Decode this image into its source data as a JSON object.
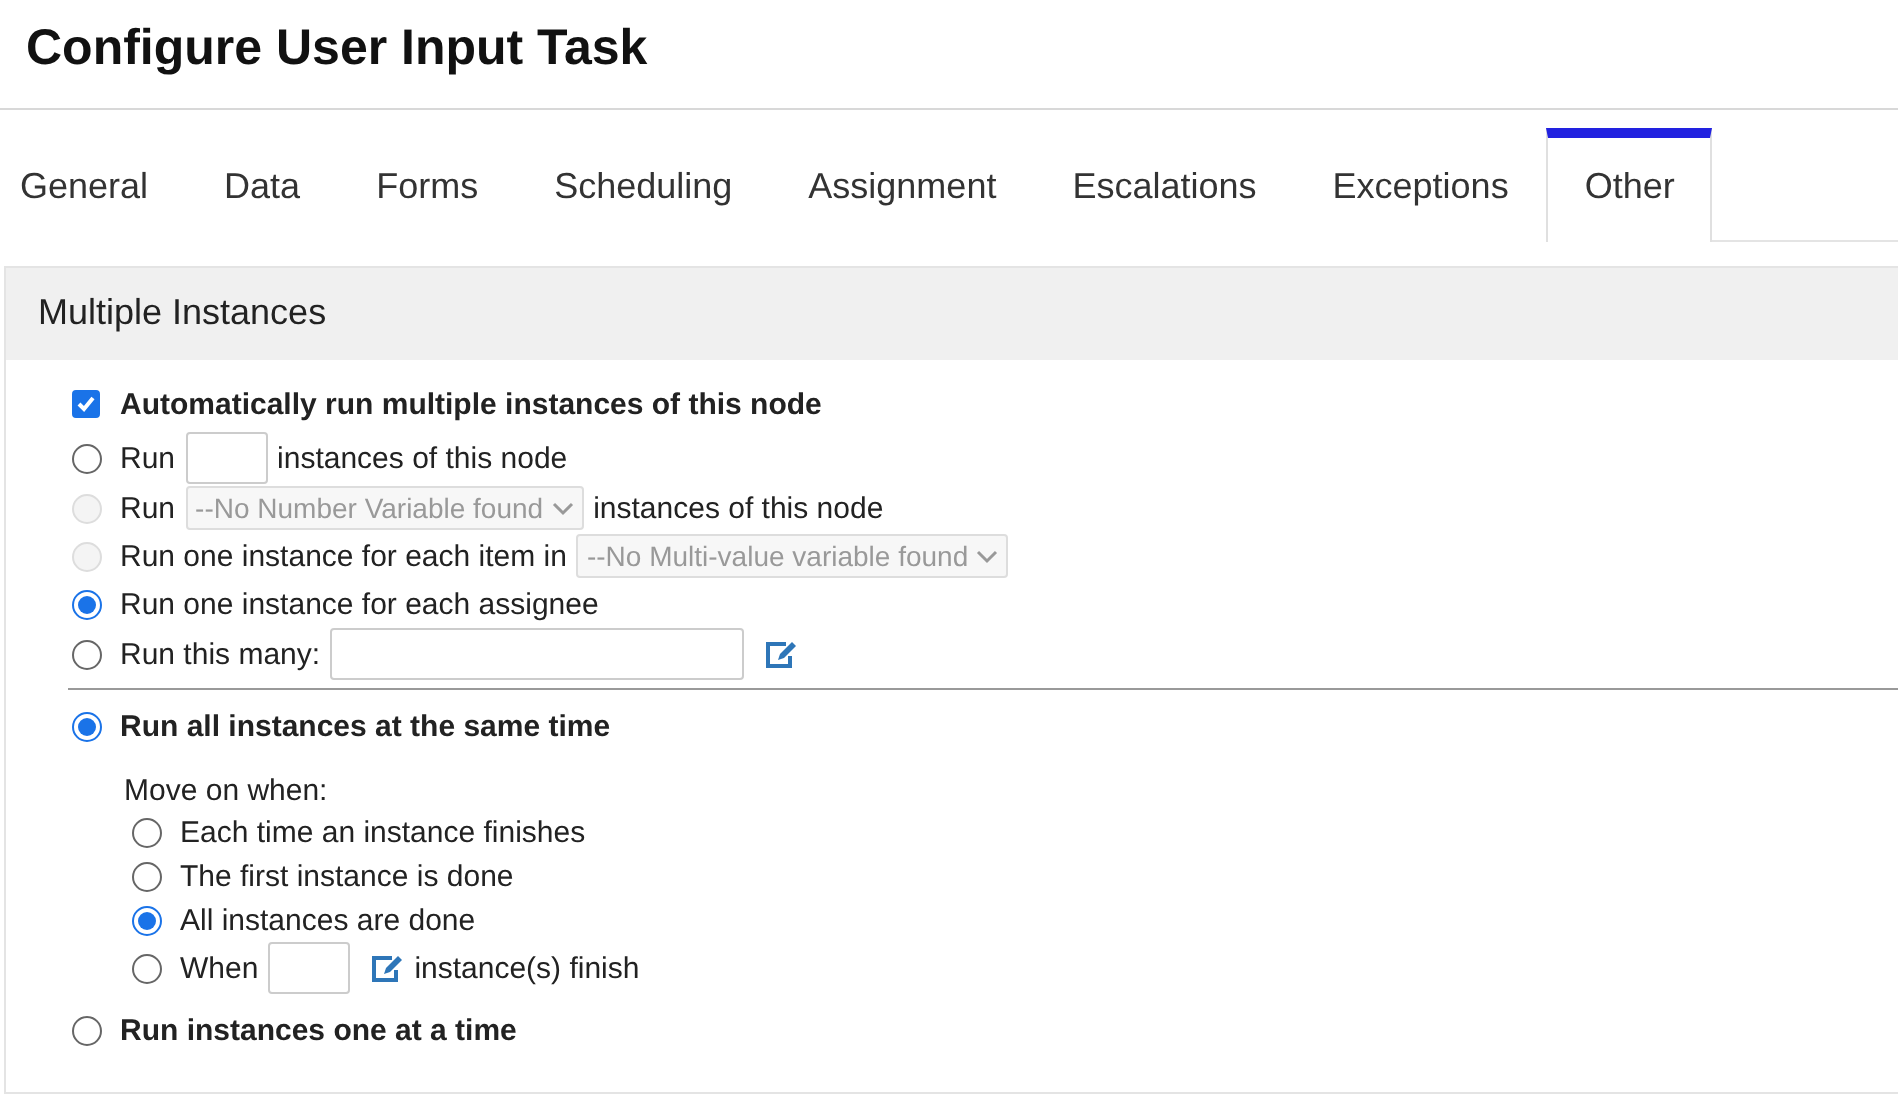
{
  "title": "Configure User Input Task",
  "tabs": [
    {
      "label": "General",
      "selected": false
    },
    {
      "label": "Data",
      "selected": false
    },
    {
      "label": "Forms",
      "selected": false
    },
    {
      "label": "Scheduling",
      "selected": false
    },
    {
      "label": "Assignment",
      "selected": false
    },
    {
      "label": "Escalations",
      "selected": false
    },
    {
      "label": "Exceptions",
      "selected": false
    },
    {
      "label": "Other",
      "selected": true
    }
  ],
  "section": {
    "title": "Multiple Instances",
    "auto_run": {
      "label": "Automatically run multiple instances of this node",
      "checked": true
    },
    "count_options": [
      {
        "selected": false,
        "disabled": false,
        "parts": [
          {
            "kind": "text",
            "text": "Run"
          },
          {
            "kind": "input"
          },
          {
            "kind": "text",
            "text": "instances of this node"
          }
        ]
      },
      {
        "selected": false,
        "disabled": true,
        "parts": [
          {
            "kind": "text",
            "text": "Run"
          },
          {
            "kind": "select",
            "value": "--No Number Variable found"
          },
          {
            "kind": "text",
            "text": "instances of this node"
          }
        ]
      },
      {
        "selected": false,
        "disabled": true,
        "parts": [
          {
            "kind": "text",
            "text": "Run one instance for each item in"
          },
          {
            "kind": "select",
            "value": "--No Multi-value variable found"
          }
        ]
      },
      {
        "selected": true,
        "disabled": false,
        "parts": [
          {
            "kind": "text",
            "text": "Run one instance for each assignee"
          }
        ]
      },
      {
        "selected": false,
        "disabled": false,
        "parts": [
          {
            "kind": "text",
            "text": "Run this many:"
          },
          {
            "kind": "wide_input"
          },
          {
            "kind": "edit"
          }
        ]
      }
    ],
    "parallel": {
      "label": "Run all instances at the same time",
      "selected": true
    },
    "move_on_label": "Move on when:",
    "move_on_options": [
      {
        "selected": false,
        "parts": [
          {
            "kind": "text",
            "text": "Each time an instance finishes"
          }
        ]
      },
      {
        "selected": false,
        "parts": [
          {
            "kind": "text",
            "text": "The first instance is done"
          }
        ]
      },
      {
        "selected": true,
        "parts": [
          {
            "kind": "text",
            "text": "All instances are done"
          }
        ]
      },
      {
        "selected": false,
        "parts": [
          {
            "kind": "text",
            "text": "When"
          },
          {
            "kind": "input"
          },
          {
            "kind": "edit"
          },
          {
            "kind": "text",
            "text": "instance(s) finish"
          }
        ]
      }
    ],
    "sequential": {
      "label": "Run instances one at a time",
      "selected": false
    }
  }
}
